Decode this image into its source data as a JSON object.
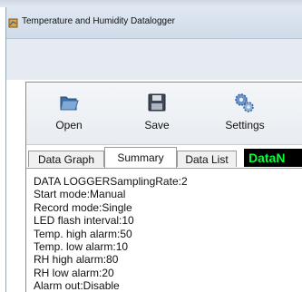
{
  "window": {
    "title": "Temperature and Humidity Datalogger"
  },
  "toolbar": {
    "buttons": [
      {
        "label": "Open",
        "icon": "folder-open-icon"
      },
      {
        "label": "Save",
        "icon": "floppy-disk-icon"
      },
      {
        "label": "Settings",
        "icon": "gears-icon"
      }
    ]
  },
  "tabs": [
    {
      "label": "Data Graph",
      "active": false
    },
    {
      "label": "Summary",
      "active": true
    },
    {
      "label": "Data List",
      "active": false
    }
  ],
  "brand_badge": "DataN",
  "summary_lines": [
    "DATA LOGGERSamplingRate:2",
    "Start mode:Manual",
    "Record mode:Single",
    "LED flash interval:10",
    "Temp. high alarm:50",
    "Temp. low alarm:10",
    "RH high alarm:80",
    "RH low alarm:20",
    "Alarm out:Disable"
  ],
  "colors": {
    "badge_bg": "#000000",
    "badge_text": "#00ff33"
  }
}
